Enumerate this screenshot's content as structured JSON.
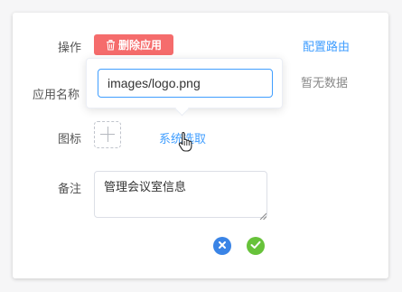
{
  "form": {
    "operation_label": "操作",
    "delete_button_label": "删除应用",
    "config_route_link": "配置路由",
    "app_name_label": "应用名称",
    "no_data_text": "暂无数据",
    "icon_label": "图标",
    "system_select_link": "系统选取",
    "remark_label": "备注",
    "remark_value": "管理会议室信息"
  },
  "popover": {
    "input_value": "images/logo.png"
  },
  "icons": {
    "delete": "trash-icon",
    "upload": "plus-icon",
    "cancel": "close-icon",
    "confirm": "check-icon",
    "cursor": "hand-pointer-icon"
  },
  "colors": {
    "danger": "#f56c6c",
    "primary": "#409eff",
    "success": "#67c23a",
    "cancel": "#3a84e6"
  }
}
